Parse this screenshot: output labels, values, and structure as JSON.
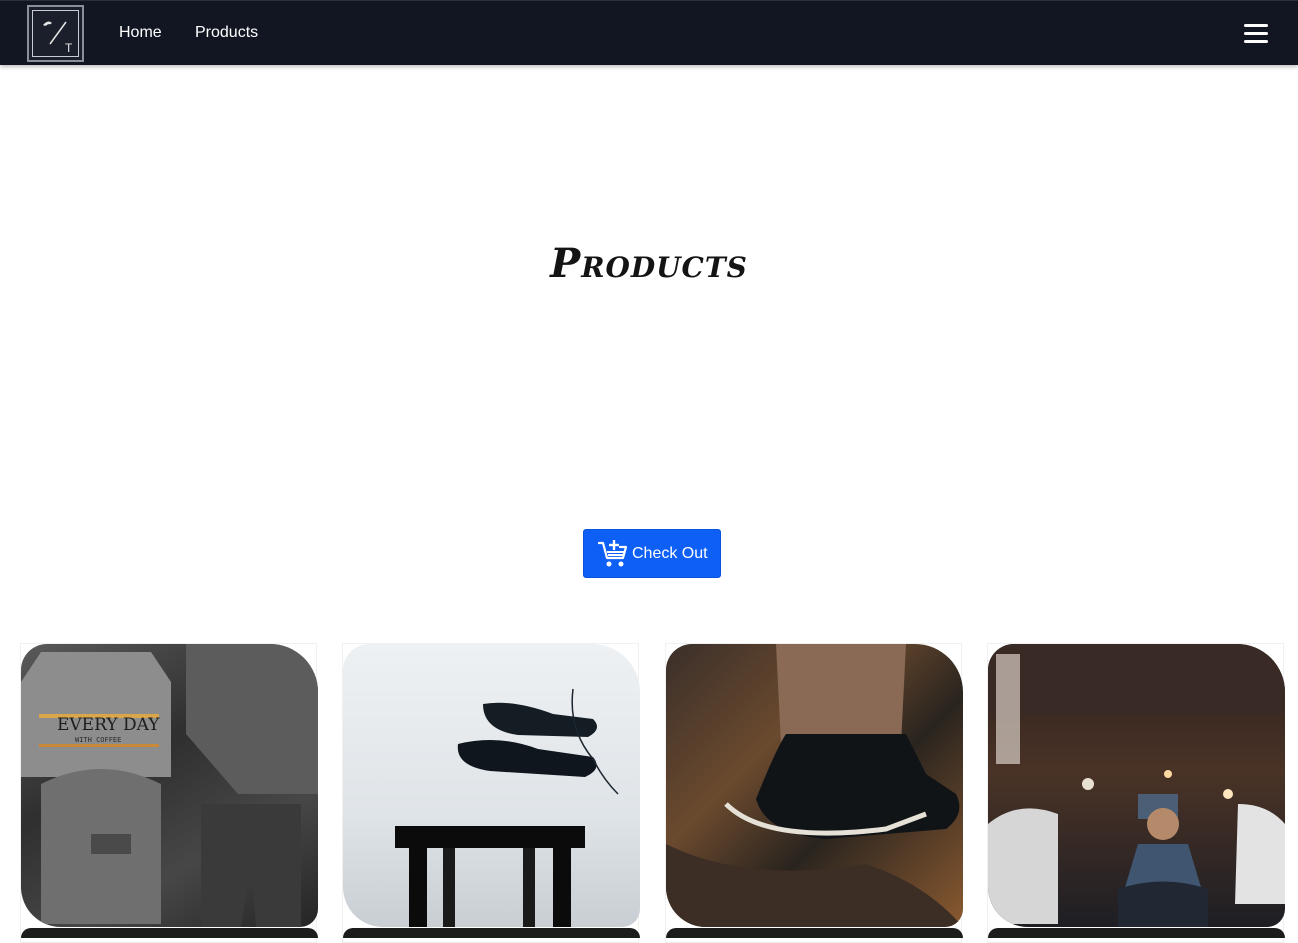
{
  "navbar": {
    "logo_text": "T",
    "links": [
      {
        "label": "Home"
      },
      {
        "label": "Products"
      }
    ]
  },
  "page": {
    "title": "Products"
  },
  "checkout": {
    "label": "Check Out",
    "icon": "cart-plus-icon"
  },
  "products": [
    {
      "image": "flatlay-clothes-backpack",
      "shirt_text": "EVERY DAY",
      "shirt_subtext": "WITH COFFEE"
    },
    {
      "image": "floating-dress-shoes-stool"
    },
    {
      "image": "black-sneaker-on-rock"
    },
    {
      "image": "man-sitting-street-night"
    }
  ],
  "colors": {
    "navbar_bg": "#111622",
    "accent": "#0d5ff5",
    "background": "#ffffff"
  }
}
